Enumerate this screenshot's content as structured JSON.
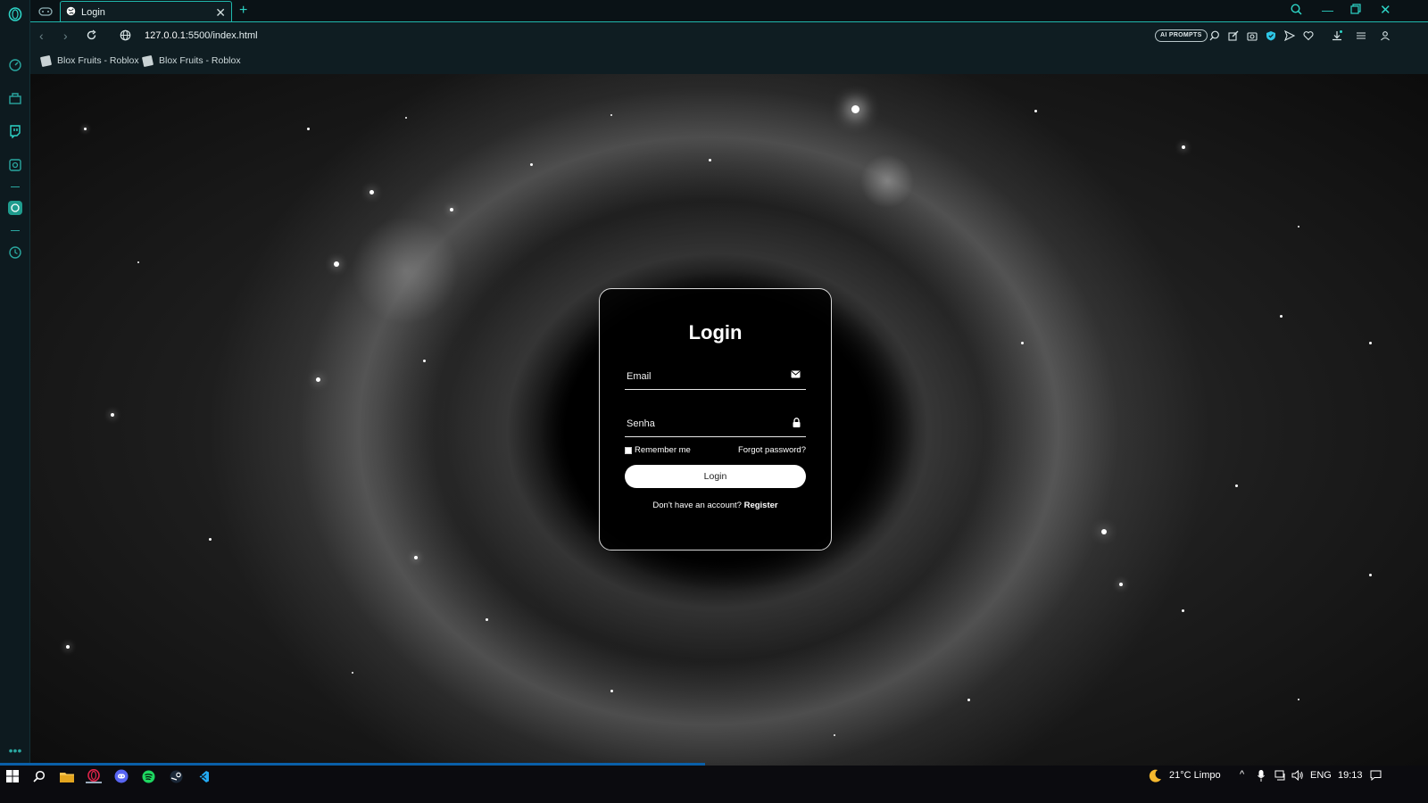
{
  "browser": {
    "tab_title": "Login",
    "url_host": "127.0.0.1",
    "url_rest": ":5500/index.html",
    "ai_prompts_label": "AI PROMPTS",
    "bookmarks": [
      "Blox Fruits - Roblox",
      "Blox Fruits - Roblox"
    ]
  },
  "login": {
    "title": "Login",
    "email_placeholder": "Email",
    "password_placeholder": "Senha",
    "remember_label": "Remember me",
    "forgot_label": "Forgot password?",
    "submit_label": "Login",
    "no_account_text": "Don't have an account?",
    "register_label": "Register"
  },
  "taskbar": {
    "weather": "21°C  Limpo",
    "language": "ENG",
    "time": "19:13"
  },
  "colors": {
    "accent": "#1fb8ad",
    "card_border": "#d7d7d7"
  }
}
